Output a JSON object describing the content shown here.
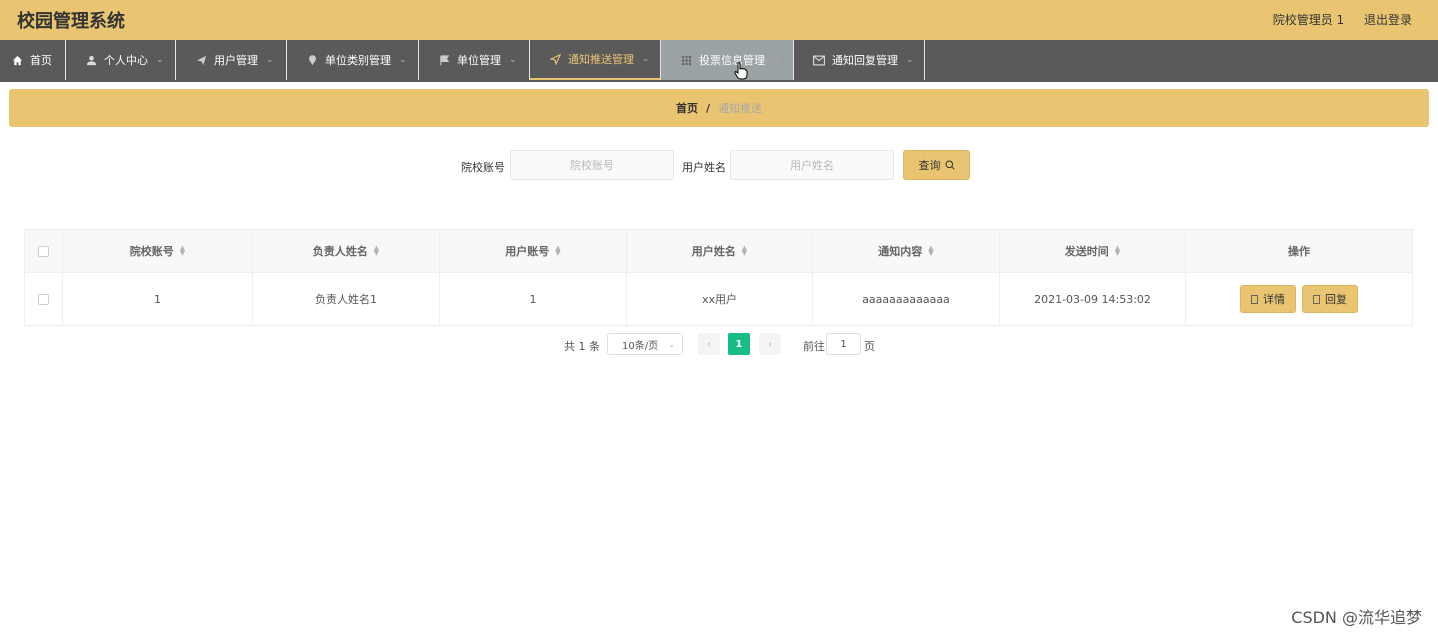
{
  "header": {
    "app_title": "校园管理系统",
    "user_label": "院校管理员 1",
    "logout_label": "退出登录"
  },
  "nav": [
    {
      "label": "首页",
      "icon": "home-icon",
      "caret": ""
    },
    {
      "label": "个人中心",
      "icon": "user-icon",
      "caret": "⌄"
    },
    {
      "label": "用户管理",
      "icon": "send-icon",
      "caret": "⌄"
    },
    {
      "label": "单位类别管理",
      "icon": "location-icon",
      "caret": "⌄"
    },
    {
      "label": "单位管理",
      "icon": "flag-icon",
      "caret": "⌄"
    },
    {
      "label": "通知推送管理",
      "icon": "navigation-icon",
      "caret": "⌄"
    },
    {
      "label": "投票信息管理",
      "icon": "grid-icon",
      "caret": "⌄"
    },
    {
      "label": "通知回复管理",
      "icon": "mail-icon",
      "caret": "⌄"
    }
  ],
  "breadcrumb": {
    "home": "首页",
    "separator": "/",
    "current": "通知推送"
  },
  "search": {
    "account_label": "院校账号",
    "account_placeholder": "院校账号",
    "username_label": "用户姓名",
    "username_placeholder": "用户姓名",
    "query_label": "查询"
  },
  "table": {
    "columns": [
      "院校账号",
      "负责人姓名",
      "用户账号",
      "用户姓名",
      "通知内容",
      "发送时间",
      "操作"
    ],
    "rows": [
      {
        "account": "1",
        "manager": "负责人姓名1",
        "user_account": "1",
        "user_name": "xx用户",
        "content": "aaaaaaaaaaaaa",
        "time": "2021-03-09 14:53:02"
      }
    ],
    "detail_label": "详情",
    "reply_label": "回复"
  },
  "pager": {
    "total": "共 1 条",
    "page_size": "10条/页",
    "current_page": "1",
    "goto_label": "前往",
    "goto_value": "1",
    "unit": "页"
  },
  "watermark": "CSDN @流华追梦",
  "colors": {
    "accent": "#e9c572",
    "nav_bg": "#5a5a5a",
    "pager_active": "#18bc86"
  }
}
